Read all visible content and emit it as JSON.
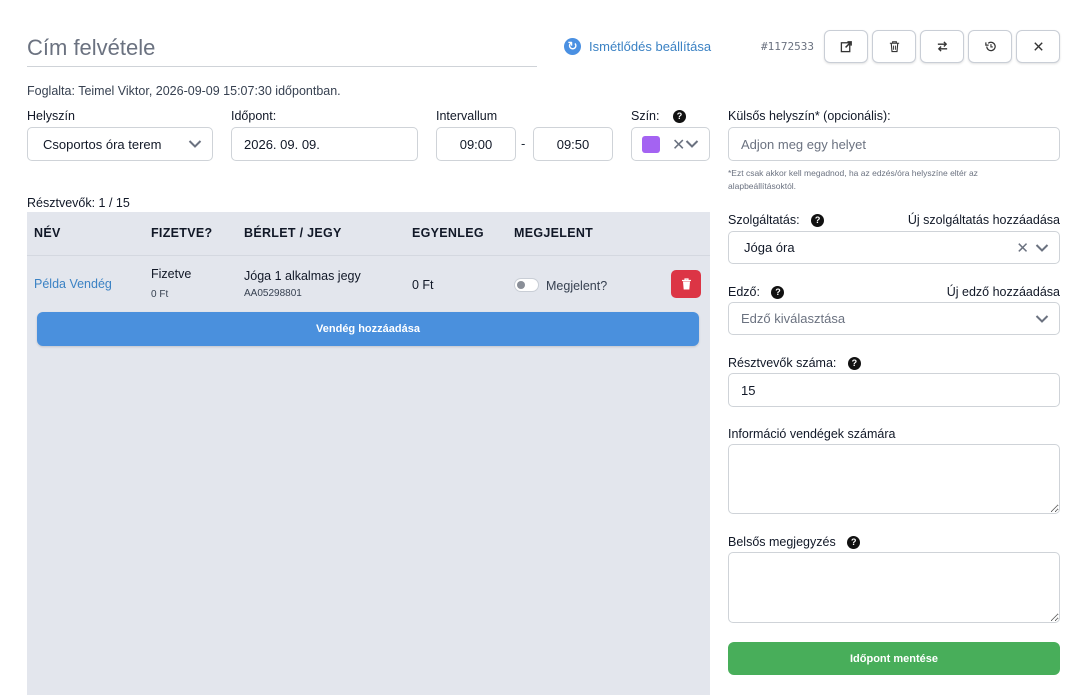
{
  "header": {
    "title_placeholder": "Cím felvétele",
    "recurrence_label": "Ismétlődés beállítása",
    "reference_id": "#1172533",
    "tools": [
      "share-icon",
      "trash-icon",
      "swap-icon",
      "history-icon",
      "close-icon"
    ]
  },
  "booked_by": "Foglalta: Teimel Viktor, 2026-09-09 15:07:30 időpontban.",
  "form": {
    "location_label": "Helyszín",
    "location_value": "Csoportos óra terem",
    "date_label": "Időpont:",
    "date_value": "2026. 09. 09.",
    "interval_label": "Intervallum",
    "interval_start": "09:00",
    "interval_separator": "-",
    "interval_end": "09:50",
    "color_label": "Szín:",
    "color_value": "#a463f2",
    "external_location_label": "Külsős helyszín* (opcionális):",
    "external_location_placeholder": "Adjon meg egy helyet",
    "external_location_hint": "*Ezt csak akkor kell megadnod, ha az edzés/óra helyszíne eltér az alapbeállításoktól."
  },
  "participants": {
    "label": "Résztvevők: 1 / 15",
    "columns": [
      "NÉV",
      "FIZETVE?",
      "BÉRLET / JEGY",
      "EGYENLEG",
      "MEGJELENT"
    ],
    "rows": [
      {
        "name": "Példa Vendég",
        "paid_status": "Fizetve",
        "paid_amount": "0 Ft",
        "pass_name": "Jóga 1 alkalmas jegy",
        "pass_code": "AA05298801",
        "balance": "0 Ft",
        "attended_label": "Megjelent?",
        "attended": false
      }
    ],
    "add_guest_label": "Vendég hozzáadása"
  },
  "sidebar": {
    "service_label": "Szolgáltatás:",
    "service_add_link": "Új szolgáltatás hozzáadása",
    "service_value": "Jóga óra",
    "trainer_label": "Edző:",
    "trainer_add_link": "Új edző hozzáadása",
    "trainer_placeholder": "Edző kiválasztása",
    "participant_count_label": "Résztvevők száma:",
    "participant_count_value": "15",
    "guest_info_label": "Információ vendégek számára",
    "internal_note_label": "Belsős megjegyzés",
    "save_label": "Időpont mentése"
  },
  "colors": {
    "primary": "#4a90dd",
    "success": "#48ae5a",
    "danger": "#dc3545",
    "panel": "#e3e6ed"
  }
}
